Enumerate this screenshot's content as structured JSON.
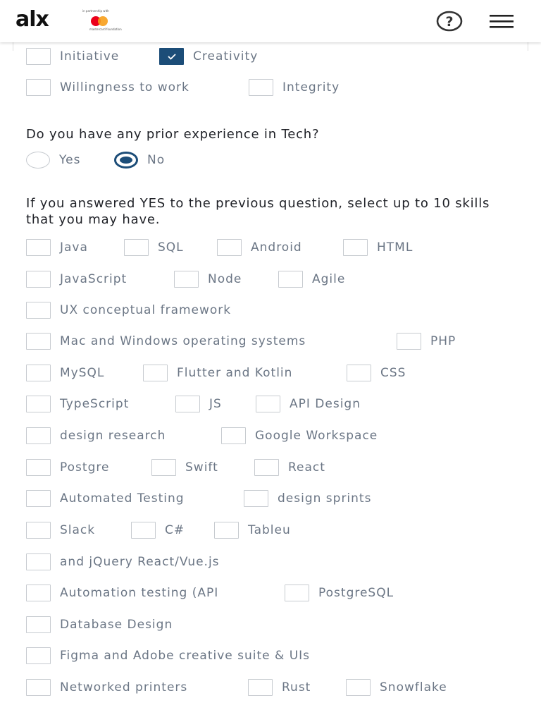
{
  "header": {
    "logo_text": "alx",
    "partner_caption": "in partnership with",
    "partner_name": "mastercard foundation",
    "help_icon": "question-circle-icon",
    "menu_icon": "hamburger-menu-icon"
  },
  "colors": {
    "accent": "#1c4d78",
    "label": "#6b7685",
    "border": "#c7cbd0"
  },
  "traits": [
    {
      "label": "Initiative",
      "checked": false
    },
    {
      "label": "Creativity",
      "checked": true
    },
    {
      "label": "Willingness to work",
      "checked": false
    },
    {
      "label": "Integrity",
      "checked": false
    }
  ],
  "experience_question": "Do you have any prior experience in Tech?",
  "experience_options": [
    {
      "label": "Yes",
      "selected": false
    },
    {
      "label": "No",
      "selected": true
    }
  ],
  "skills_question": "If you answered YES to the previous question, select up to 10 skills that you may have.",
  "skills": [
    {
      "label": "Java",
      "checked": false
    },
    {
      "label": "SQL",
      "checked": false
    },
    {
      "label": "Android",
      "checked": false
    },
    {
      "label": "HTML",
      "checked": false
    },
    {
      "label": "JavaScript",
      "checked": false
    },
    {
      "label": "Node",
      "checked": false
    },
    {
      "label": "Agile",
      "checked": false
    },
    {
      "label": "UX conceptual framework",
      "checked": false
    },
    {
      "label": "Mac and Windows operating systems",
      "checked": false
    },
    {
      "label": "PHP",
      "checked": false
    },
    {
      "label": "MySQL",
      "checked": false
    },
    {
      "label": "Flutter and Kotlin",
      "checked": false
    },
    {
      "label": "CSS",
      "checked": false
    },
    {
      "label": "TypeScript",
      "checked": false
    },
    {
      "label": "JS",
      "checked": false
    },
    {
      "label": "API Design",
      "checked": false
    },
    {
      "label": "design research",
      "checked": false
    },
    {
      "label": "Google Workspace",
      "checked": false
    },
    {
      "label": "Postgre",
      "checked": false
    },
    {
      "label": "Swift",
      "checked": false
    },
    {
      "label": "React",
      "checked": false
    },
    {
      "label": "Automated Testing",
      "checked": false
    },
    {
      "label": "design sprints",
      "checked": false
    },
    {
      "label": "Slack",
      "checked": false
    },
    {
      "label": "C#",
      "checked": false
    },
    {
      "label": "Tableu",
      "checked": false
    },
    {
      "label": "and jQuery React/Vue.js",
      "checked": false
    },
    {
      "label": "Automation testing (API",
      "checked": false
    },
    {
      "label": "PostgreSQL",
      "checked": false
    },
    {
      "label": "Database Design",
      "checked": false
    },
    {
      "label": "Figma and Adobe creative suite & UIs",
      "checked": false
    },
    {
      "label": "Networked printers",
      "checked": false
    },
    {
      "label": "Rust",
      "checked": false
    },
    {
      "label": "Snowflake",
      "checked": false
    }
  ]
}
